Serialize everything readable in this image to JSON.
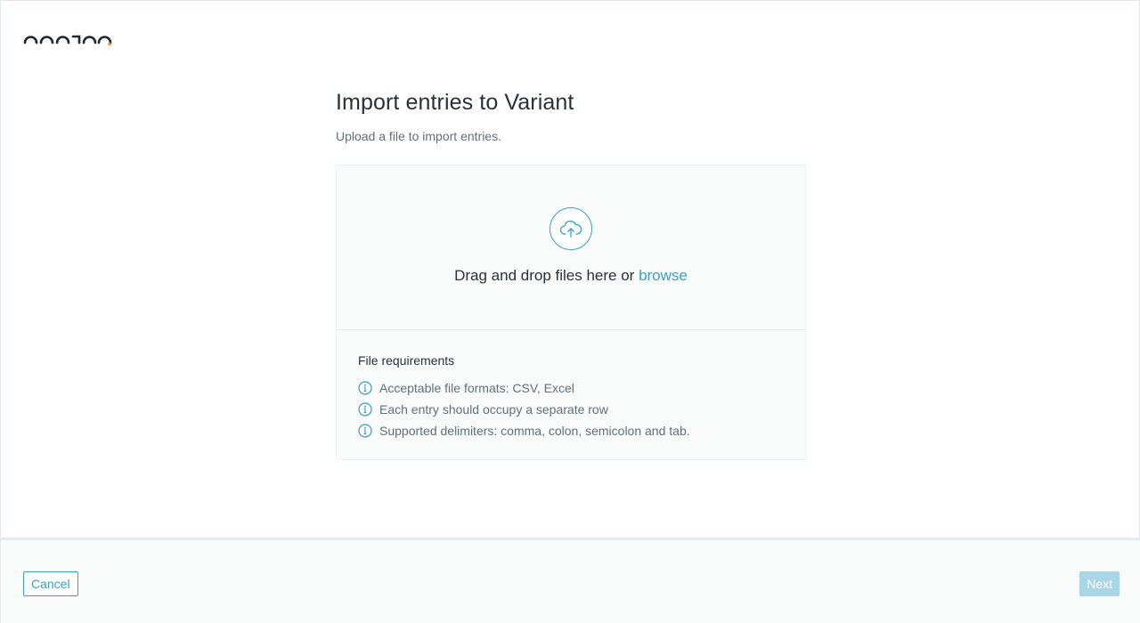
{
  "header": {
    "logo_icon": "brand-logo"
  },
  "main": {
    "title": "Import entries to Variant",
    "subtitle": "Upload a file to import entries.",
    "dropzone": {
      "icon": "cloud-upload-icon",
      "text": "Drag and drop files here or ",
      "browse_label": "browse"
    },
    "requirements": {
      "title": "File requirements",
      "items": [
        {
          "icon": "info-icon",
          "text": "Acceptable file formats: CSV, Excel"
        },
        {
          "icon": "info-icon",
          "text": "Each entry should occupy a separate row"
        },
        {
          "icon": "info-icon",
          "text": "Supported delimiters: comma, colon, semicolon and tab."
        }
      ]
    }
  },
  "footer": {
    "cancel_label": "Cancel",
    "next_label": "Next",
    "next_disabled": true
  },
  "colors": {
    "accent": "#3a9fc0",
    "accent_disabled": "#a8d6e6",
    "logo_dot": "#f0883a",
    "text_primary": "#263238",
    "text_secondary": "#607078"
  }
}
